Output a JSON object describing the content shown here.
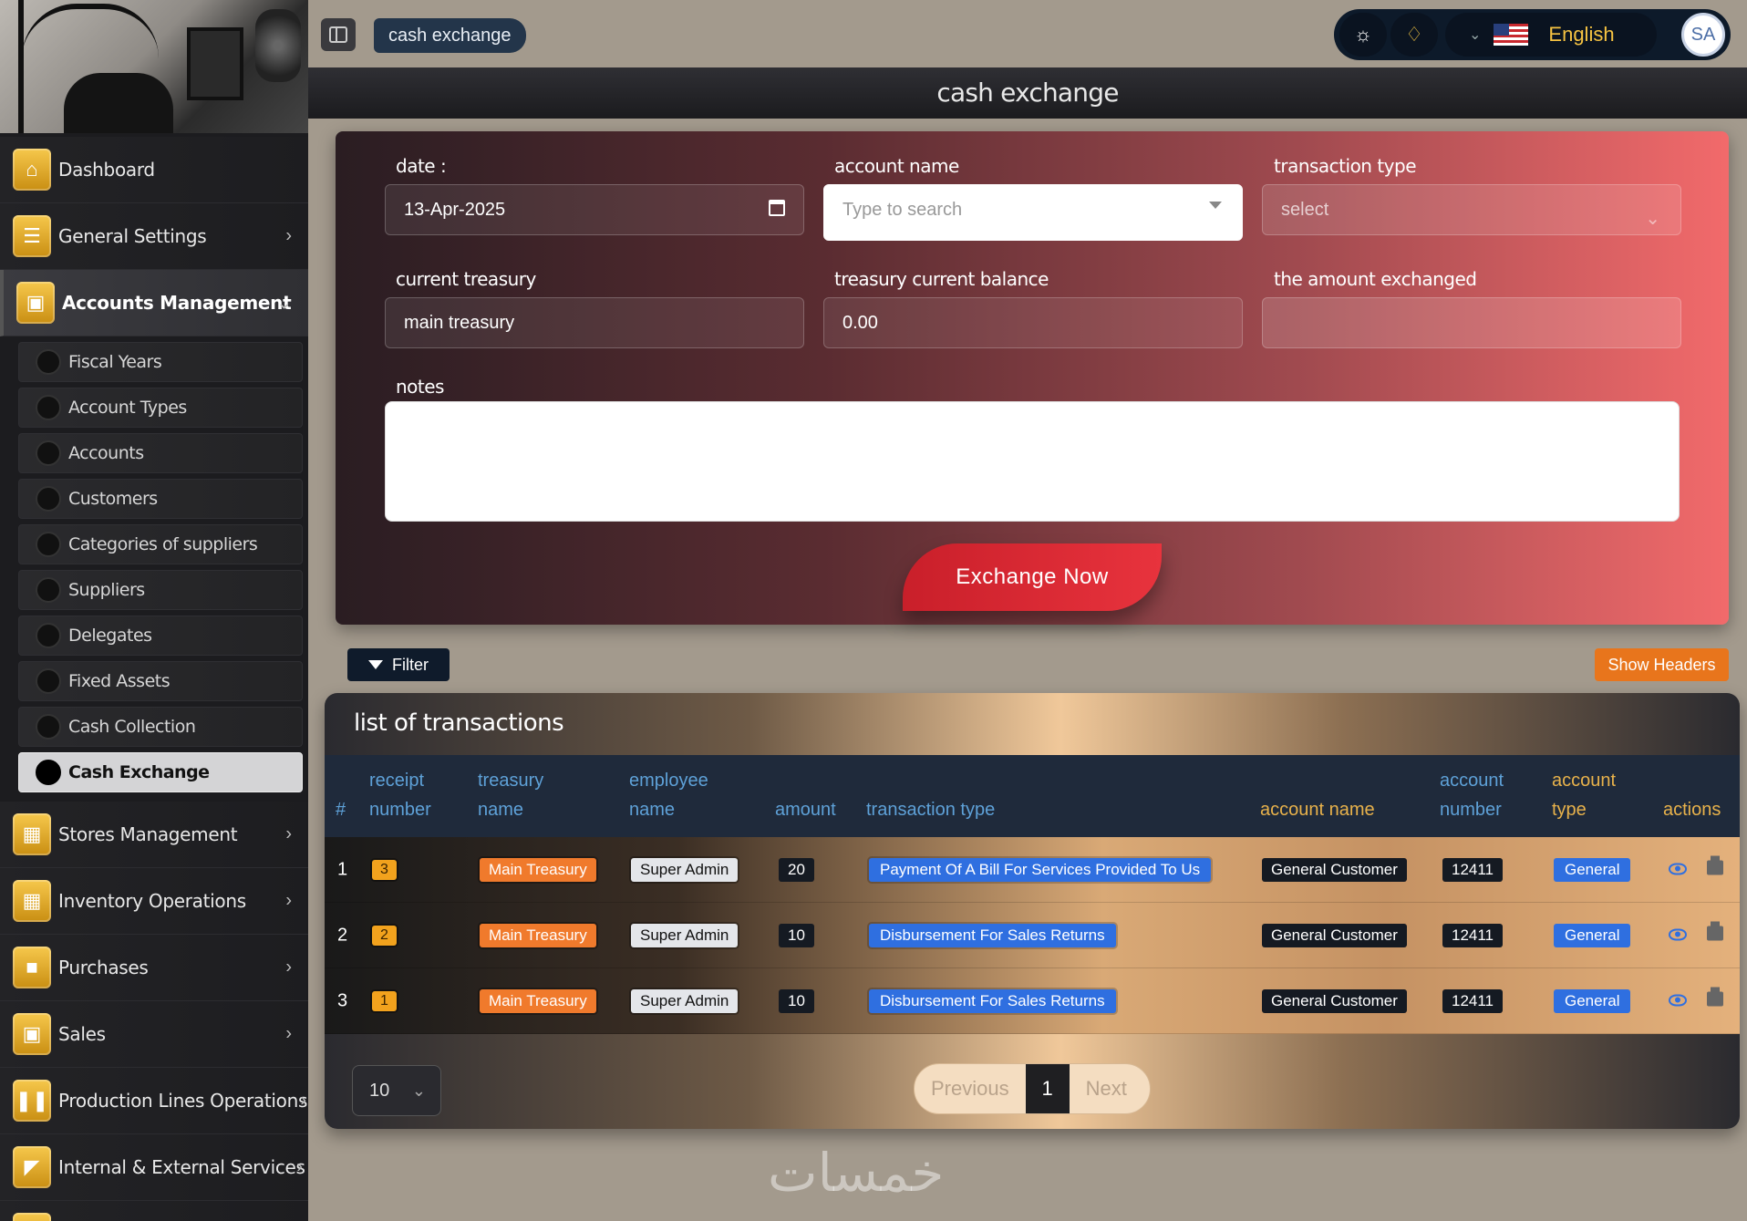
{
  "sidebar": {
    "items": [
      {
        "label": "Dashboard",
        "icon": "home-icon",
        "has_children": false
      },
      {
        "label": "General Settings",
        "icon": "sliders-icon",
        "has_children": true
      },
      {
        "label": "Accounts Management",
        "icon": "wallet-icon",
        "has_children": true,
        "expanded": true
      },
      {
        "label": "Stores Management",
        "icon": "building-icon",
        "has_children": true
      },
      {
        "label": "Inventory Operations",
        "icon": "building-icon",
        "has_children": true
      },
      {
        "label": "Purchases",
        "icon": "bag-icon",
        "has_children": true
      },
      {
        "label": "Sales",
        "icon": "cart-icon",
        "has_children": true
      },
      {
        "label": "Production Lines Operations",
        "icon": "bars-icon",
        "has_children": true
      },
      {
        "label": "Internal & External Services",
        "icon": "service-icon",
        "has_children": true
      }
    ],
    "subitems": [
      "Fiscal Years",
      "Account Types",
      "Accounts",
      "Customers",
      "Categories of suppliers",
      "Suppliers",
      "Delegates",
      "Fixed Assets",
      "Cash Collection",
      "Cash Exchange"
    ],
    "active_subitem": "Cash Exchange"
  },
  "topbar": {
    "breadcrumb": "cash exchange",
    "language": "English",
    "avatar_initials": "SA"
  },
  "page": {
    "title": "cash exchange"
  },
  "form": {
    "date_label": "date :",
    "date_value": "13-Apr-2025",
    "account_name_label": "account name",
    "account_name_placeholder": "Type to search",
    "transaction_type_label": "transaction type",
    "transaction_type_value": "select",
    "current_treasury_label": "current treasury",
    "current_treasury_value": "main treasury",
    "balance_label": "treasury current balance",
    "balance_value": "0.00",
    "amount_label": "the amount exchanged",
    "amount_value": "",
    "notes_label": "notes",
    "submit_label": "Exchange Now"
  },
  "toolbar": {
    "filter_label": "Filter",
    "show_headers_label": "Show Headers"
  },
  "table": {
    "title": "list of transactions",
    "headers": {
      "index": "#",
      "receipt_number": "receipt number",
      "treasury_name": "treasury name",
      "employee_name": "employee name",
      "amount": "amount",
      "transaction_type": "transaction type",
      "account_name": "account name",
      "account_number": "account number",
      "account_type": "account type",
      "actions": "actions"
    },
    "rows": [
      {
        "index": "1",
        "receipt": "3",
        "treasury": "Main Treasury",
        "employee": "Super Admin",
        "amount": "20",
        "type": "Payment Of A Bill For Services Provided To Us",
        "account_name": "General Customer",
        "account_number": "12411",
        "account_type": "General"
      },
      {
        "index": "2",
        "receipt": "2",
        "treasury": "Main Treasury",
        "employee": "Super Admin",
        "amount": "10",
        "type": "Disbursement For Sales Returns",
        "account_name": "General Customer",
        "account_number": "12411",
        "account_type": "General"
      },
      {
        "index": "3",
        "receipt": "1",
        "treasury": "Main Treasury",
        "employee": "Super Admin",
        "amount": "10",
        "type": "Disbursement For Sales Returns",
        "account_name": "General Customer",
        "account_number": "12411",
        "account_type": "General"
      }
    ]
  },
  "pagination": {
    "per_page": "10",
    "previous_label": "Previous",
    "current_page": "1",
    "next_label": "Next"
  },
  "watermark": "خمسات",
  "colors": {
    "accent_gold": "#f6c84c",
    "exchange_button": "#e8333d",
    "show_headers": "#e8751c",
    "badge_blue": "#2f6fe0",
    "badge_orange": "#f07a2c"
  }
}
